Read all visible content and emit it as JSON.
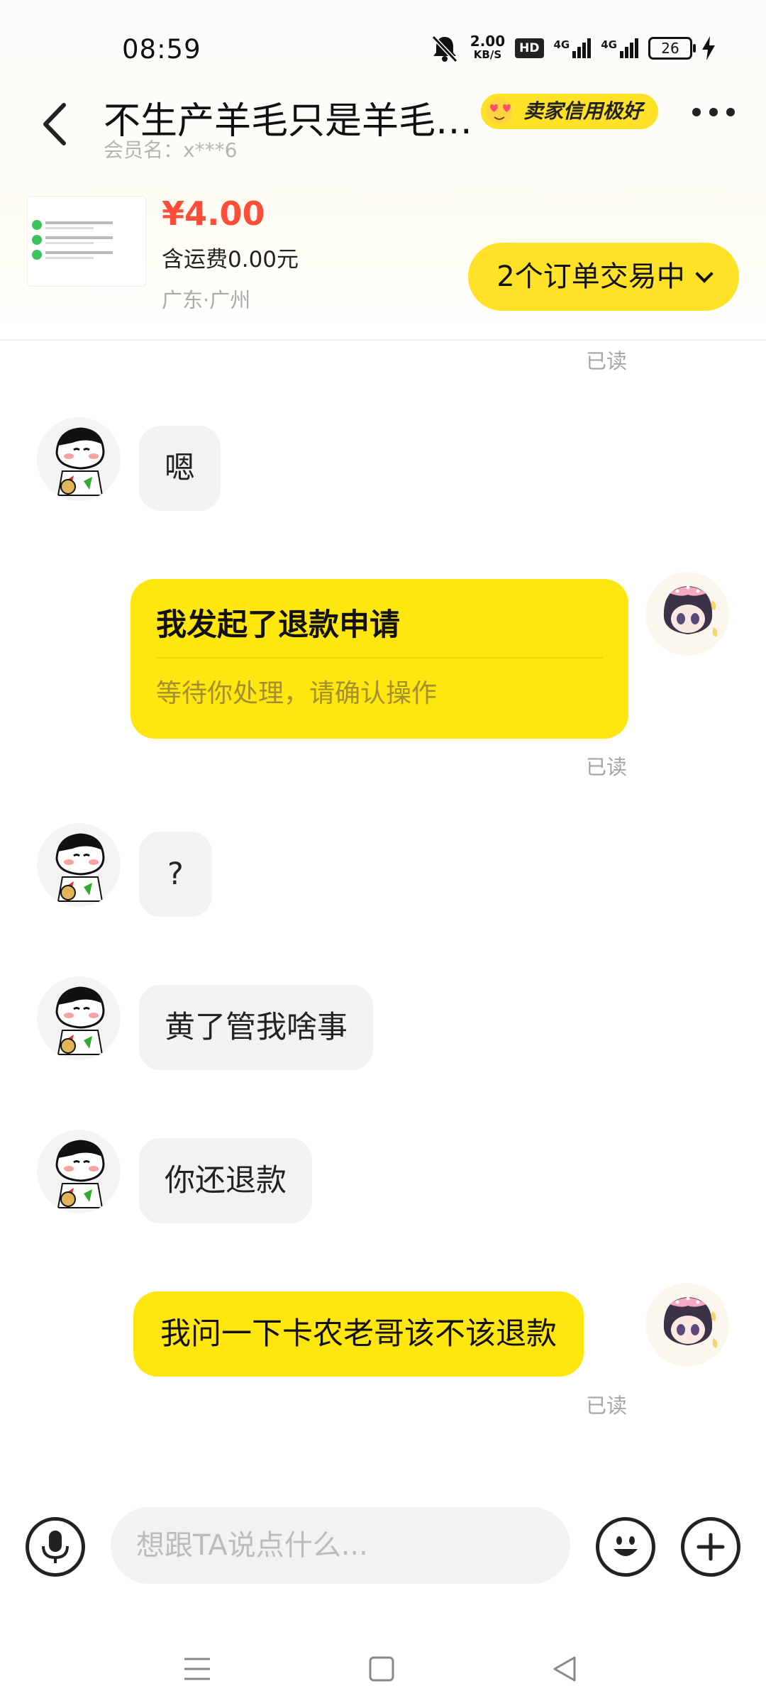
{
  "status_bar": {
    "time": "08:59",
    "net_speed_value": "2.00",
    "net_speed_unit": "KB/S",
    "hd_label": "HD",
    "signal1_label": "4G",
    "signal2_label": "4G",
    "battery": "26"
  },
  "header": {
    "title": "不生产羊毛只是羊毛…",
    "member_label": "会员名：x***6",
    "credit_badge": "卖家信用极好"
  },
  "order": {
    "price": "¥4.00",
    "shipping": "含运费0.00元",
    "location": "广东·广州",
    "orders_button": "2个订单交易中"
  },
  "messages": [
    {
      "side": "read_status",
      "text": "已读"
    },
    {
      "side": "in",
      "text": "嗯"
    },
    {
      "side": "out_card",
      "title": "我发起了退款申请",
      "subtitle": "等待你处理，请确认操作",
      "status": "已读"
    },
    {
      "side": "in",
      "text": "?"
    },
    {
      "side": "in",
      "text": "黄了管我啥事"
    },
    {
      "side": "in",
      "text": "你还退款"
    },
    {
      "side": "out",
      "text": "我问一下卡农老哥该不该退款",
      "status": "已读"
    }
  ],
  "composer": {
    "placeholder": "想跟TA说点什么..."
  },
  "icons": {
    "back": "chevron-left-icon",
    "more": "more-icon",
    "mic": "mic-icon",
    "emoji": "smile-icon",
    "plus": "plus-icon",
    "nav_menu": "menu-icon",
    "nav_home": "square-icon",
    "nav_back": "triangle-back-icon"
  },
  "colors": {
    "accent": "#ffe60f",
    "price": "#ff4d3a",
    "bubble_in": "#f2f2f4"
  }
}
